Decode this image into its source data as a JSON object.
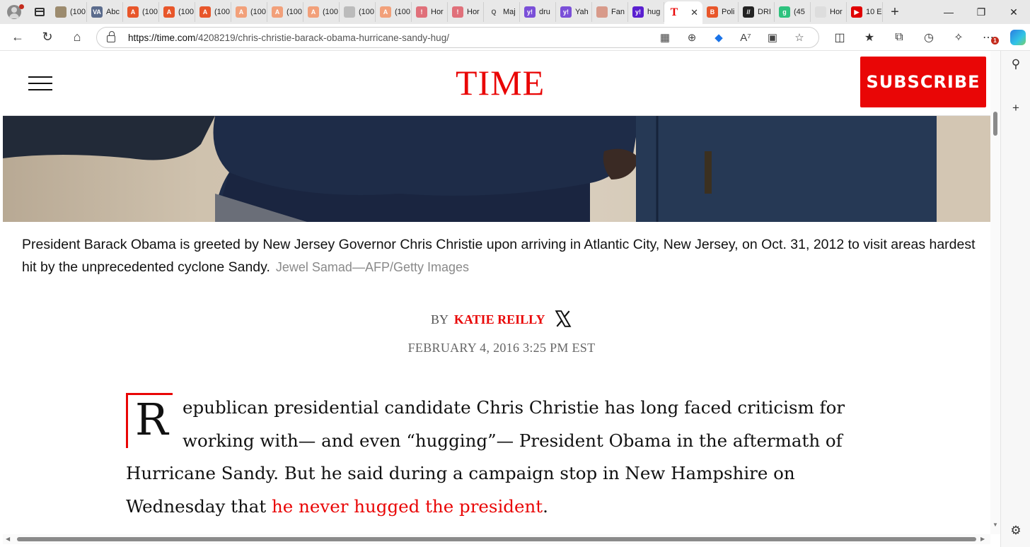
{
  "browser": {
    "tabs": [
      {
        "label": "(100",
        "color": "#9c8b6e"
      },
      {
        "label": "Abc",
        "color": "#5a6b8c",
        "glyph": "VA"
      },
      {
        "label": "(100",
        "color": "#e8562a",
        "glyph": "A"
      },
      {
        "label": "(100",
        "color": "#e8562a",
        "glyph": "A"
      },
      {
        "label": "(100",
        "color": "#e8562a",
        "glyph": "A"
      },
      {
        "label": "(100",
        "color": "#f2a07a",
        "glyph": "A"
      },
      {
        "label": "(100",
        "color": "#f2a07a",
        "glyph": "A"
      },
      {
        "label": "(100",
        "color": "#f2a07a",
        "glyph": "A"
      },
      {
        "label": "(100",
        "color": "#bbbbbb",
        "glyph": ""
      },
      {
        "label": "(100",
        "color": "#f2a07a",
        "glyph": "A"
      },
      {
        "label": "Hor",
        "color": "#e0707a",
        "glyph": "!"
      },
      {
        "label": "Hor",
        "color": "#e0707a",
        "glyph": "!"
      },
      {
        "label": "Maj",
        "color": "#e8e8e8",
        "glyph": "Q"
      },
      {
        "label": "dru",
        "color": "#7a4fd8",
        "glyph": "y!"
      },
      {
        "label": "Yah",
        "color": "#7a4fd8",
        "glyph": "y!"
      },
      {
        "label": "Fan",
        "color": "#d89a8a",
        "glyph": ""
      },
      {
        "label": "hug",
        "color": "#5a1fd0",
        "glyph": "y!"
      },
      {
        "label": "",
        "color": "#ffffff",
        "glyph": "T",
        "active": true
      },
      {
        "label": "Poli",
        "color": "#e8562a",
        "glyph": "B"
      },
      {
        "label": "DRI",
        "color": "#222222",
        "glyph": "//"
      },
      {
        "label": "(45",
        "color": "#2ec27e",
        "glyph": "g"
      },
      {
        "label": "Hor",
        "color": "#dddddd",
        "glyph": ""
      },
      {
        "label": "10 E",
        "color": "#e00000",
        "glyph": "▶"
      }
    ],
    "url_host": "https://time.com",
    "url_path": "/4208219/chris-christie-barack-obama-hurricane-sandy-hug/",
    "notification_count": "1"
  },
  "site": {
    "logo": "TIME",
    "subscribe_label": "SUBSCRIBE"
  },
  "photo": {
    "caption": "President Barack Obama is greeted by New Jersey Governor Chris Christie upon arriving in Atlantic City, New Jersey, on Oct. 31, 2012 to visit areas hardest hit by the unprecedented cyclone Sandy.",
    "credit": "Jewel Samad—AFP/Getty Images"
  },
  "byline": {
    "by": "BY",
    "author": "KATIE REILLY",
    "date": "FEBRUARY 4, 2016 3:25 PM EST"
  },
  "article": {
    "dropcap": "R",
    "body_start": "epublican presidential candidate Chris Christie has long faced criticism for working with— and even “hugging”— President Obama in the aftermath of Hurricane Sandy. But he said during a campaign stop in New Hampshire on Wednesday that ",
    "link_text": "he never hugged the president",
    "body_end": "."
  }
}
